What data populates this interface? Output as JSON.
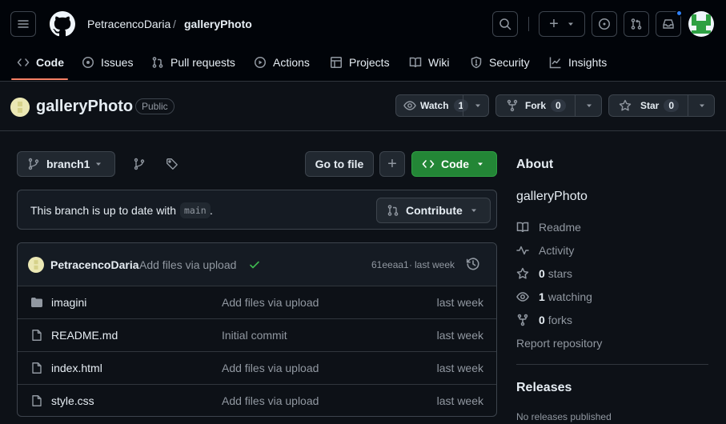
{
  "header": {
    "owner": "PetracencoDaria",
    "separator": "/",
    "repo": "galleryPhoto",
    "plus": "+",
    "notification_color": "#2f81f7"
  },
  "nav": {
    "tabs": [
      {
        "label": "Code",
        "icon": "code-icon",
        "active": true
      },
      {
        "label": "Issues",
        "icon": "issue-opened-icon"
      },
      {
        "label": "Pull requests",
        "icon": "git-pull-request-icon"
      },
      {
        "label": "Actions",
        "icon": "play-icon"
      },
      {
        "label": "Projects",
        "icon": "table-icon"
      },
      {
        "label": "Wiki",
        "icon": "book-icon"
      },
      {
        "label": "Security",
        "icon": "shield-icon"
      },
      {
        "label": "Insights",
        "icon": "graph-icon"
      }
    ],
    "active_color": "#f78166"
  },
  "repo": {
    "name": "galleryPhoto",
    "visibility": "Public",
    "watch_label": "Watch",
    "watch_count": "1",
    "fork_label": "Fork",
    "fork_count": "0",
    "star_label": "Star",
    "star_count": "0"
  },
  "toolbar": {
    "branch": "branch1",
    "go_to_file": "Go to file",
    "add": "+",
    "code_label": "Code",
    "code_color": "#238636"
  },
  "branch_status": {
    "text": "This branch is up to date with",
    "base": "main",
    "period": ".",
    "contribute_label": "Contribute"
  },
  "commit": {
    "author": "PetracencoDaria",
    "message": "Add files via upload",
    "sha": "61eeaa1",
    "separator": "·",
    "time": "last week",
    "status_color": "#3fb950"
  },
  "files": [
    {
      "name": "imagini",
      "type": "folder",
      "message": "Add files via upload",
      "date": "last week"
    },
    {
      "name": "README.md",
      "type": "file",
      "message": "Initial commit",
      "date": "last week"
    },
    {
      "name": "index.html",
      "type": "file",
      "message": "Add files via upload",
      "date": "last week"
    },
    {
      "name": "style.css",
      "type": "file",
      "message": "Add files via upload",
      "date": "last week"
    }
  ],
  "about": {
    "heading": "About",
    "description": "galleryPhoto",
    "readme": "Readme",
    "activity": "Activity",
    "stars_count": "0",
    "stars_label": "stars",
    "watching_count": "1",
    "watching_label": "watching",
    "forks_count": "0",
    "forks_label": "forks",
    "report": "Report repository"
  },
  "releases": {
    "heading": "Releases",
    "empty": "No releases published"
  }
}
